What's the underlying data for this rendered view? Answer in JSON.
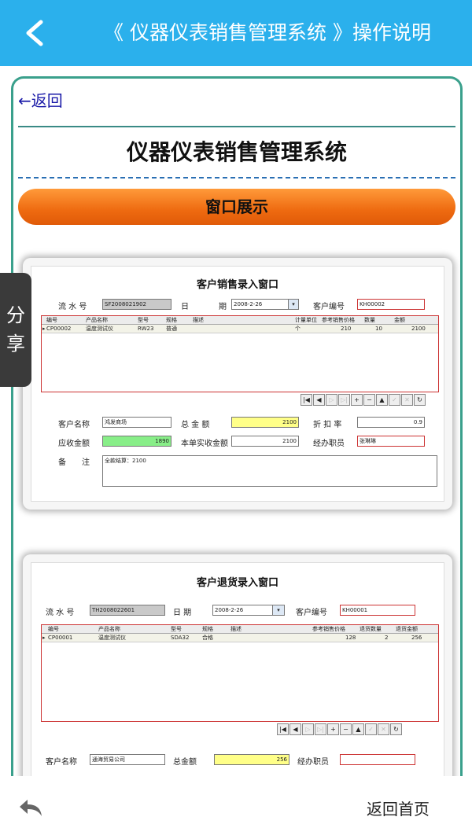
{
  "header": {
    "title": "《 仪器仪表销售管理系统 》操作说明"
  },
  "content": {
    "back_link": "←返回",
    "app_title": "仪器仪表销售管理系统",
    "section_button": "窗口展示"
  },
  "sales_window": {
    "title": "客户销售录入窗口",
    "serial_label": "流 水 号",
    "serial_value": "SF2008021902",
    "date_label1": "日",
    "date_label2": "期",
    "date_value": "2008-2-26",
    "customer_no_label": "客户编号",
    "customer_no_value": "KH00002",
    "grid_headers": [
      "编号",
      "产品名称",
      "型号",
      "规格",
      "描述",
      "计量单位",
      "参考销售价格",
      "数量",
      "金额"
    ],
    "grid_row": [
      "CP00002",
      "温度测试仪",
      "RW23",
      "普通",
      "",
      "个",
      "210",
      "10",
      "2100"
    ],
    "customer_name_label": "客户名称",
    "customer_name_value": "鸿发商场",
    "total_label": "总 金 额",
    "total_value": "2100",
    "discount_label": "折 扣 率",
    "discount_value": "0.9",
    "receivable_label": "应收金额",
    "receivable_value": "1890",
    "actual_label": "本单实收金额",
    "actual_value": "2100",
    "staff_label": "经办职员",
    "staff_value": "张琳琳",
    "remark_label1": "备",
    "remark_label2": "注",
    "remark_value": "全款结算：2100"
  },
  "return_window": {
    "title": "客户退货录入窗口",
    "serial_label": "流 水 号",
    "serial_value": "TH2008022601",
    "date_label": "日 期",
    "date_value": "2008-2-26",
    "customer_no_label": "客户编号",
    "customer_no_value": "KH00001",
    "grid_headers": [
      "编号",
      "产品名称",
      "型号",
      "规格",
      "描述",
      "参考销售价格",
      "退货数量",
      "退货金额"
    ],
    "grid_row": [
      "CP00001",
      "温度测试仪",
      "SDA32",
      "合格",
      "",
      "128",
      "2",
      "256"
    ],
    "customer_name_label": "客户名称",
    "customer_name_value": "通海贸易公司",
    "total_label": "总金额",
    "total_value": "256",
    "staff_label": "经办职员",
    "staff_value": ""
  },
  "nav_buttons": [
    "|◀",
    "◀",
    "▷",
    "▷|",
    "+",
    "−",
    "▲",
    "✓",
    "✕",
    "↻"
  ],
  "share": {
    "line1": "分",
    "line2": "享"
  },
  "footer": {
    "home_label": "返回首页"
  }
}
